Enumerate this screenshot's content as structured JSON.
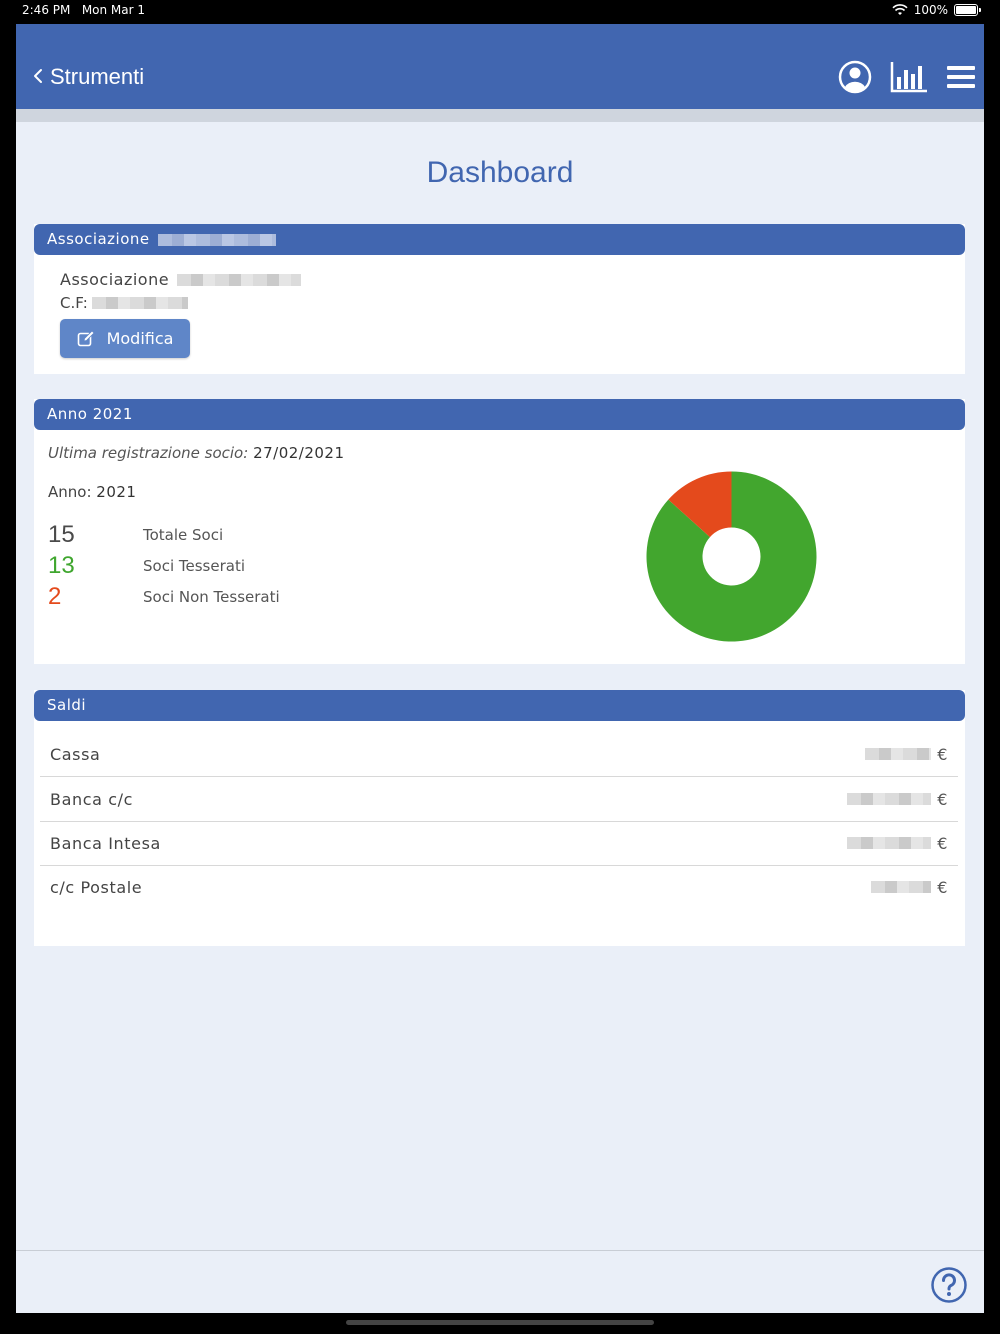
{
  "status_bar": {
    "time": "2:46 PM",
    "date": "Mon Mar 1",
    "battery": "100%"
  },
  "navbar": {
    "back_label": "Strumenti",
    "icons": [
      "user-circle-icon",
      "bar-chart-icon",
      "hamburger-menu-icon"
    ]
  },
  "page_title": "Dashboard",
  "association_card": {
    "header": "Associazione",
    "name_label": "Associazione",
    "cf_label": "C.F:",
    "edit_button": "Modifica"
  },
  "year_card": {
    "header": "Anno 2021",
    "last_registration_label": "Ultima registrazione socio:",
    "last_registration_date": "27/02/2021",
    "year_label": "Anno:",
    "year_value": "2021",
    "stats": [
      {
        "value": "15",
        "label": "Totale Soci",
        "color": "#4a4a4a"
      },
      {
        "value": "13",
        "label": "Soci Tesserati",
        "color": "#3fa62e"
      },
      {
        "value": "2",
        "label": "Soci Non Tesserati",
        "color": "#e44a1c"
      }
    ],
    "chart": {
      "tesserati": 13,
      "non_tesserati": 2,
      "colors": [
        "#42a62e",
        "#e44a1c"
      ]
    }
  },
  "balances_card": {
    "header": "Saldi",
    "currency": "€",
    "rows": [
      {
        "label": "Cassa"
      },
      {
        "label": "Banca c/c"
      },
      {
        "label": "Banca Intesa"
      },
      {
        "label": "c/c Postale"
      }
    ]
  },
  "colors": {
    "primary": "#4166b0",
    "background": "#eaeff8",
    "button": "#5f86c8"
  }
}
